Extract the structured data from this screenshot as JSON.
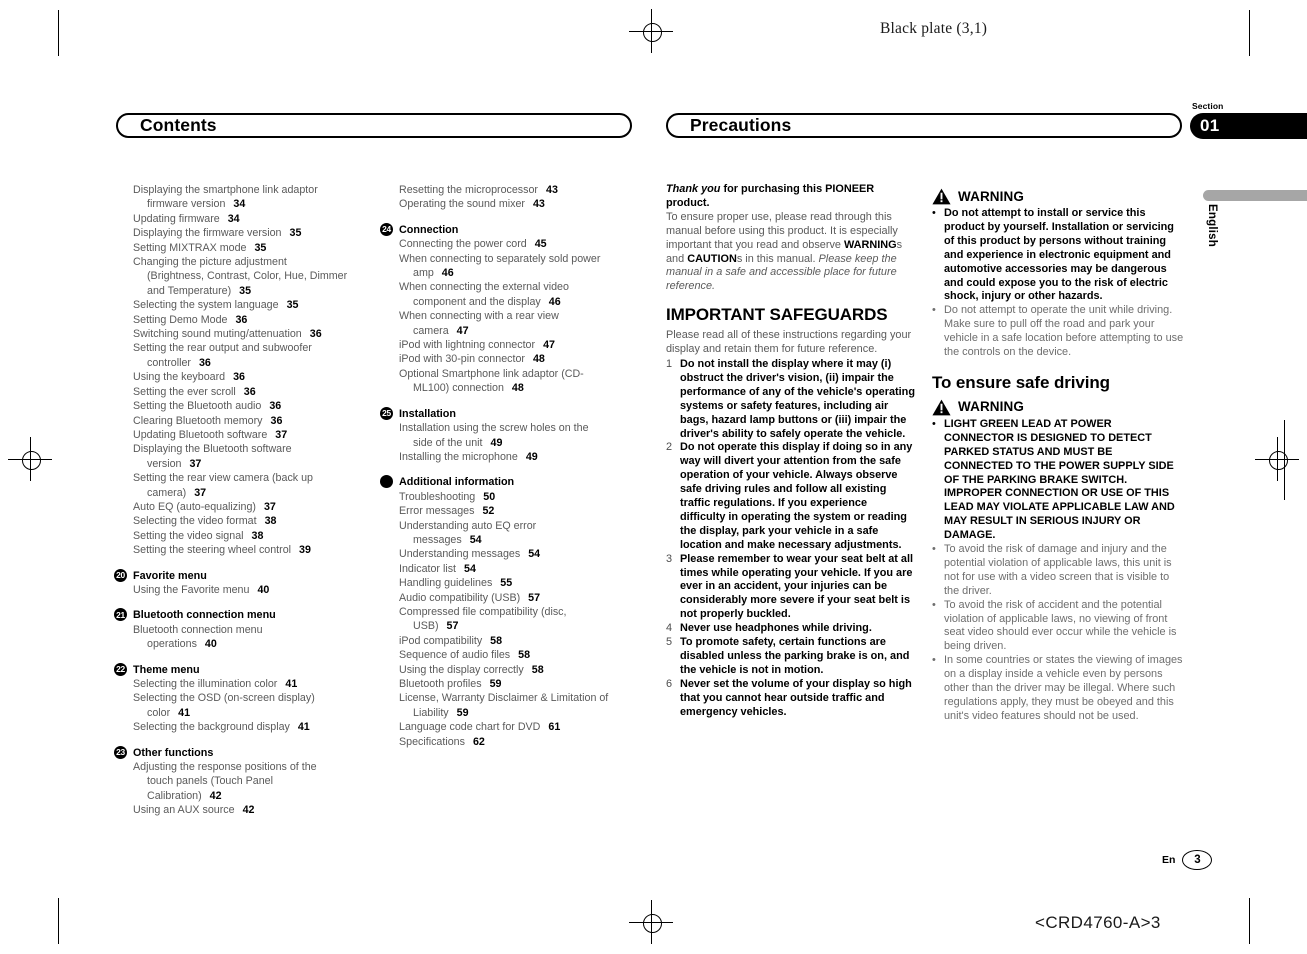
{
  "print_marks": {
    "black_plate": "Black plate (3,1)",
    "crd_code": "<CRD4760-A>3"
  },
  "section_tab": {
    "section_word": "Section",
    "number": "01"
  },
  "language_tab": {
    "label": "English"
  },
  "left_page": {
    "banner_title": "Contents",
    "col1": [
      {
        "type": "entry",
        "text": "Displaying the smartphone link adaptor",
        "indent": false
      },
      {
        "type": "entry",
        "text": "firmware version",
        "num": "34",
        "indent": true
      },
      {
        "type": "entry",
        "text": "Updating firmware",
        "num": "34",
        "indent": false
      },
      {
        "type": "entry",
        "text": "Displaying the firmware version",
        "num": "35",
        "indent": false
      },
      {
        "type": "entry",
        "text": "Setting MIXTRAX mode",
        "num": "35",
        "indent": false
      },
      {
        "type": "entry",
        "text": "Changing the picture adjustment",
        "indent": false
      },
      {
        "type": "entry",
        "text": "(Brightness, Contrast, Color, Hue, Dimmer",
        "indent": true
      },
      {
        "type": "entry",
        "text": "and Temperature)",
        "num": "35",
        "indent": true
      },
      {
        "type": "entry",
        "text": "Selecting the system language",
        "num": "35",
        "indent": false
      },
      {
        "type": "entry",
        "text": "Setting Demo Mode",
        "num": "36",
        "indent": false
      },
      {
        "type": "entry",
        "text": "Switching sound muting/attenuation",
        "num": "36",
        "indent": false
      },
      {
        "type": "entry",
        "text": "Setting the rear output and subwoofer",
        "indent": false
      },
      {
        "type": "entry",
        "text": "controller",
        "num": "36",
        "indent": true
      },
      {
        "type": "entry",
        "text": "Using the keyboard",
        "num": "36",
        "indent": false
      },
      {
        "type": "entry",
        "text": "Setting the ever scroll",
        "num": "36",
        "indent": false
      },
      {
        "type": "entry",
        "text": "Setting the Bluetooth audio",
        "num": "36",
        "indent": false
      },
      {
        "type": "entry",
        "text": "Clearing Bluetooth memory",
        "num": "36",
        "indent": false
      },
      {
        "type": "entry",
        "text": "Updating Bluetooth software",
        "num": "37",
        "indent": false
      },
      {
        "type": "entry",
        "text": "Displaying the Bluetooth software",
        "indent": false
      },
      {
        "type": "entry",
        "text": "version",
        "num": "37",
        "indent": true
      },
      {
        "type": "entry",
        "text": "Setting the rear view camera (back up",
        "indent": false
      },
      {
        "type": "entry",
        "text": "camera)",
        "num": "37",
        "indent": true
      },
      {
        "type": "entry",
        "text": "Auto EQ (auto-equalizing)",
        "num": "37",
        "indent": false
      },
      {
        "type": "entry",
        "text": "Selecting the video format",
        "num": "38",
        "indent": false
      },
      {
        "type": "entry",
        "text": "Setting the video signal",
        "num": "38",
        "indent": false
      },
      {
        "type": "entry",
        "text": "Setting the steering wheel control",
        "num": "39",
        "indent": false
      }
    ],
    "col1_groups": [
      {
        "marker": "20",
        "title": "Favorite menu",
        "entries": [
          {
            "text": "Using the Favorite menu",
            "num": "40",
            "indent": false
          }
        ]
      },
      {
        "marker": "21",
        "title": "Bluetooth connection menu",
        "entries": [
          {
            "text": "Bluetooth connection menu",
            "indent": false
          },
          {
            "text": "operations",
            "num": "40",
            "indent": true
          }
        ]
      },
      {
        "marker": "22",
        "title": "Theme menu",
        "entries": [
          {
            "text": "Selecting the illumination color",
            "num": "41",
            "indent": false
          },
          {
            "text": "Selecting the OSD (on-screen display)",
            "indent": false
          },
          {
            "text": "color",
            "num": "41",
            "indent": true
          },
          {
            "text": "Selecting the background display",
            "num": "41",
            "indent": false
          }
        ]
      },
      {
        "marker": "23",
        "title": "Other functions",
        "entries": [
          {
            "text": "Adjusting the response positions of the",
            "indent": false
          },
          {
            "text": "touch panels (Touch Panel",
            "indent": true
          },
          {
            "text": "Calibration)",
            "num": "42",
            "indent": true
          },
          {
            "text": "Using an AUX source",
            "num": "42",
            "indent": false
          }
        ]
      }
    ],
    "col2_top": [
      {
        "text": "Resetting the microprocessor",
        "num": "43",
        "indent": false
      },
      {
        "text": "Operating the sound mixer",
        "num": "43",
        "indent": false
      }
    ],
    "col2_groups": [
      {
        "marker": "24",
        "title": "Connection",
        "entries": [
          {
            "text": "Connecting the power cord",
            "num": "45",
            "indent": false
          },
          {
            "text": "When connecting to separately sold power",
            "indent": false
          },
          {
            "text": "amp",
            "num": "46",
            "indent": true
          },
          {
            "text": "When connecting the external video",
            "indent": false
          },
          {
            "text": "component and the display",
            "num": "46",
            "indent": true
          },
          {
            "text": "When connecting with a rear view",
            "indent": false
          },
          {
            "text": "camera",
            "num": "47",
            "indent": true
          },
          {
            "text": "iPod with lightning connector",
            "num": "47",
            "indent": false
          },
          {
            "text": "iPod with 30-pin connector",
            "num": "48",
            "indent": false
          },
          {
            "text": "Optional Smartphone link adaptor (CD-",
            "indent": false
          },
          {
            "text": "ML100) connection",
            "num": "48",
            "indent": true
          }
        ]
      },
      {
        "marker": "25",
        "title": "Installation",
        "entries": [
          {
            "text": "Installation using the screw holes on the",
            "indent": false
          },
          {
            "text": "side of the unit",
            "num": "49",
            "indent": true
          },
          {
            "text": "Installing the microphone",
            "num": "49",
            "indent": false
          }
        ]
      },
      {
        "marker": "dot",
        "title": "Additional information",
        "entries": [
          {
            "text": "Troubleshooting",
            "num": "50",
            "indent": false
          },
          {
            "text": "Error messages",
            "num": "52",
            "indent": false
          },
          {
            "text": "Understanding auto EQ error",
            "indent": false
          },
          {
            "text": "messages",
            "num": "54",
            "indent": true
          },
          {
            "text": "Understanding messages",
            "num": "54",
            "indent": false
          },
          {
            "text": "Indicator list",
            "num": "54",
            "indent": false
          },
          {
            "text": "Handling guidelines",
            "num": "55",
            "indent": false
          },
          {
            "text": "Audio compatibility (USB)",
            "num": "57",
            "indent": false
          },
          {
            "text": "Compressed file compatibility (disc,",
            "indent": false
          },
          {
            "text": "USB)",
            "num": "57",
            "indent": true
          },
          {
            "text": "iPod compatibility",
            "num": "58",
            "indent": false
          },
          {
            "text": "Sequence of audio files",
            "num": "58",
            "indent": false
          },
          {
            "text": "Using the display correctly",
            "num": "58",
            "indent": false
          },
          {
            "text": "Bluetooth profiles",
            "num": "59",
            "indent": false
          },
          {
            "text": "License, Warranty Disclaimer & Limitation of",
            "indent": false
          },
          {
            "text": "Liability",
            "num": "59",
            "indent": true
          },
          {
            "text": "Language code chart for DVD",
            "num": "61",
            "indent": false
          },
          {
            "text": "Specifications",
            "num": "62",
            "indent": false
          }
        ]
      }
    ]
  },
  "right_page": {
    "banner_title": "Precautions",
    "thank_you_italic": "Thank you",
    "thank_you_rest": " for purchasing this PIONEER product.",
    "intro_1": "To ensure proper use, please read through this manual before using this product. It is especially important that you read and observe ",
    "intro_warnings": "WARNING",
    "intro_2": "s and ",
    "intro_cautions": "CAUTION",
    "intro_3": "s in this manual. ",
    "intro_italic": "Please keep the manual in a safe and accessible place for future reference.",
    "safeguards_title": "IMPORTANT SAFEGUARDS",
    "safeguards_intro": "Please read all of these instructions regarding your display and retain them for future reference.",
    "safeguards": [
      {
        "num": "1",
        "text": "Do not install the display where it may (i) obstruct the driver's vision, (ii) impair the performance of any of the vehicle's operating systems or safety features, including air bags, hazard lamp buttons or (iii) impair the driver's ability to safely operate the vehicle."
      },
      {
        "num": "2",
        "text": "Do not operate this display if doing so in any way will divert your attention from the safe operation of your vehicle. Always observe safe driving rules and follow all existing traffic regulations. If you experience difficulty in operating the system or reading the display, park your vehicle in a safe location and make necessary adjustments."
      },
      {
        "num": "3",
        "text": "Please remember to wear your seat belt at all times while operating your vehicle. If you are ever in an accident, your injuries can be considerably more severe if your seat belt is not properly buckled."
      },
      {
        "num": "4",
        "text": "Never use headphones while driving."
      },
      {
        "num": "5",
        "text": "To promote safety, certain functions are disabled unless the parking brake is on, and the vehicle is not in motion."
      },
      {
        "num": "6",
        "text": "Never set the volume of your display so high that you cannot hear outside traffic and emergency vehicles."
      }
    ],
    "warning_label": "WARNING",
    "warning_1_items": [
      {
        "style": "bold",
        "text": "Do not attempt to install or service this product by yourself. Installation or servicing of this product by persons without training and experience in electronic equipment and automotive accessories may be dangerous and could expose you to the risk of electric shock, injury or other hazards."
      },
      {
        "style": "gray",
        "text": "Do not attempt to operate the unit while driving. Make sure to pull off the road and park your vehicle in a safe location before attempting to use the controls on the device."
      }
    ],
    "safe_driving_title": "To ensure safe driving",
    "warning_2_items": [
      {
        "style": "bold",
        "text": "LIGHT GREEN LEAD AT POWER CONNECTOR IS DESIGNED TO DETECT PARKED STATUS AND MUST BE CONNECTED TO THE POWER SUPPLY SIDE OF THE PARKING BRAKE SWITCH. IMPROPER CONNECTION OR USE OF THIS LEAD MAY VIOLATE APPLICABLE LAW AND MAY RESULT IN SERIOUS INJURY OR DAMAGE."
      },
      {
        "style": "gray",
        "text": "To avoid the risk of damage and injury and the potential violation of applicable laws, this unit is not for use with a video screen that is visible to the driver."
      },
      {
        "style": "gray",
        "text": "To avoid the risk of accident and the potential violation of applicable laws, no viewing of front seat video should ever occur while the vehicle is being driven."
      },
      {
        "style": "gray",
        "text": "In some countries or states the viewing of images on a display inside a vehicle even by persons other than the driver may be illegal. Where such regulations apply, they must be obeyed and this unit's video features should not be used."
      }
    ]
  },
  "footer": {
    "en_label": "En",
    "page_number": "3"
  },
  "bullet_glyph": "•"
}
